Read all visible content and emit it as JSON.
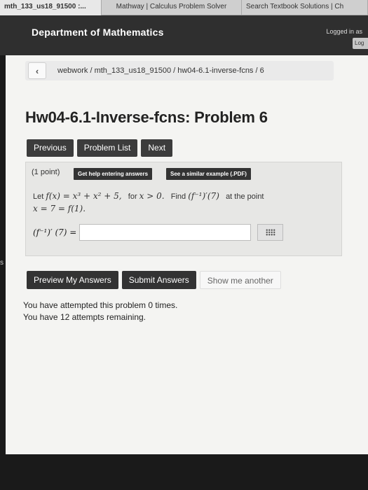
{
  "browser": {
    "tabs": [
      {
        "label": "mth_133_us18_91500 :..."
      },
      {
        "label": "Mathway | Calculus Problem Solver"
      },
      {
        "label": "Search Textbook Solutions | Ch"
      }
    ]
  },
  "header": {
    "title": "Department of Mathematics",
    "login_note": "Logged in as",
    "login_button": "Log"
  },
  "breadcrumb": {
    "back_icon": "chevron-left-icon",
    "path": "webwork / mth_133_us18_91500 / hw04-6.1-inverse-fcns / 6"
  },
  "problem": {
    "title": "Hw04-6.1-Inverse-fcns: Problem 6",
    "points": "(1 point)",
    "help_entering": "Get help entering answers",
    "similar_example": "See a similar example (.PDF)",
    "let": "Let",
    "function": "f(x) = x³ + x² + 5,",
    "for_text": "for",
    "condition": "x > 0.",
    "find": "Find",
    "target": "(f⁻¹)′(7)",
    "at_the_point": "at the point",
    "point": "x = 7 = f(1).",
    "answer_lhs": "(f⁻¹)′ (7) =",
    "answer_value": ""
  },
  "nav": {
    "previous": "Previous",
    "problem_list": "Problem List",
    "next": "Next"
  },
  "actions": {
    "preview": "Preview My Answers",
    "submit": "Submit Answers",
    "show_another": "Show me another"
  },
  "attempts": {
    "line1": "You have attempted this problem 0 times.",
    "line2": "You have 12 attempts remaining."
  },
  "left_edge_letter": "s"
}
